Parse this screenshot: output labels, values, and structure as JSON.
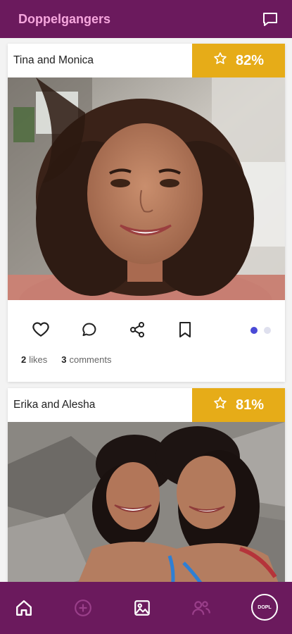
{
  "app": {
    "title": "Doppelgangers"
  },
  "icons": {
    "chat": "chat-bubble-icon",
    "star": "star-icon",
    "like": "heart-icon",
    "comment": "comment-icon",
    "share": "share-icon",
    "save": "bookmark-icon",
    "home": "home-icon",
    "add": "add-circle-icon",
    "gallery": "image-icon",
    "people": "people-icon"
  },
  "colors": {
    "header": "#6b1a5d",
    "title": "#f6a6dd",
    "badge": "#e6ac18",
    "dot_active": "#4a4ad6"
  },
  "posts": [
    {
      "names": "Tina and Monica",
      "match": "82%",
      "likes_count": "2",
      "likes_label": "likes",
      "comments_count": "3",
      "comments_label": "comments",
      "carousel_pages": 2,
      "carousel_current": 1
    },
    {
      "names": "Erika and Alesha",
      "match": "81%"
    }
  ],
  "nav": {
    "profile_label": "DOPL",
    "active": "home"
  }
}
